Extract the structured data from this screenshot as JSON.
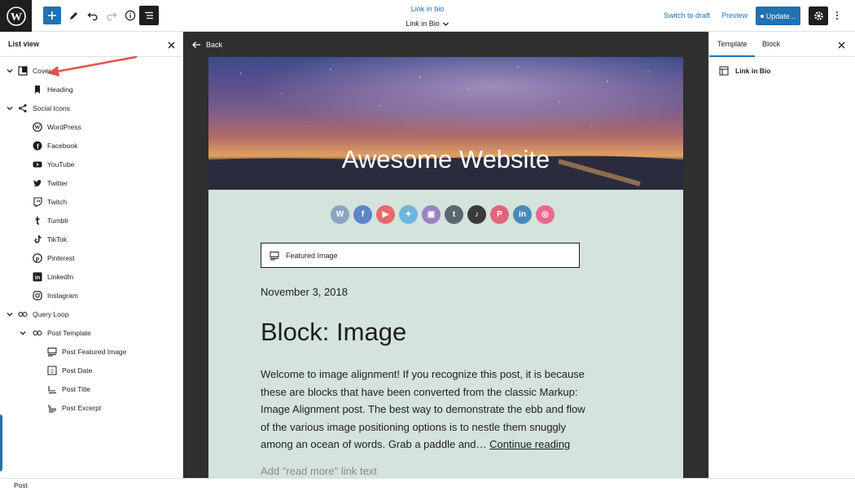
{
  "topbar": {
    "doc_subtitle": "Link in bio",
    "doc_title": "Link in Bio",
    "switch_draft": "Switch to draft",
    "preview": "Preview",
    "update": "Update..."
  },
  "list_view": {
    "title": "List view",
    "items": [
      {
        "label": "Cover",
        "level": 0,
        "icon": "cover-icon",
        "chevron": true
      },
      {
        "label": "Heading",
        "level": 1,
        "icon": "bookmark-icon",
        "chevron": false
      },
      {
        "label": "Social Icons",
        "level": 0,
        "icon": "share-icon",
        "chevron": true
      },
      {
        "label": "WordPress",
        "level": 1,
        "icon": "wordpress-icon",
        "chevron": false
      },
      {
        "label": "Facebook",
        "level": 1,
        "icon": "facebook-icon",
        "chevron": false
      },
      {
        "label": "YouTube",
        "level": 1,
        "icon": "youtube-icon",
        "chevron": false
      },
      {
        "label": "Twitter",
        "level": 1,
        "icon": "twitter-icon",
        "chevron": false
      },
      {
        "label": "Twitch",
        "level": 1,
        "icon": "twitch-icon",
        "chevron": false
      },
      {
        "label": "Tumblr",
        "level": 1,
        "icon": "tumblr-icon",
        "chevron": false
      },
      {
        "label": "TikTok",
        "level": 1,
        "icon": "tiktok-icon",
        "chevron": false
      },
      {
        "label": "Pinterest",
        "level": 1,
        "icon": "pinterest-icon",
        "chevron": false
      },
      {
        "label": "LinkedIn",
        "level": 1,
        "icon": "linkedin-icon",
        "chevron": false
      },
      {
        "label": "Instagram",
        "level": 1,
        "icon": "instagram-icon",
        "chevron": false
      },
      {
        "label": "Query Loop",
        "level": 0,
        "icon": "loop-icon",
        "chevron": true
      },
      {
        "label": "Post Template",
        "level": 1,
        "icon": "loop-icon",
        "chevron": true
      },
      {
        "label": "Post Featured Image",
        "level": 2,
        "icon": "featured-image-icon",
        "chevron": false
      },
      {
        "label": "Post Date",
        "level": 2,
        "icon": "calendar-icon",
        "chevron": false
      },
      {
        "label": "Post Title",
        "level": 2,
        "icon": "title-icon",
        "chevron": false
      },
      {
        "label": "Post Excerpt",
        "level": 2,
        "icon": "excerpt-icon",
        "chevron": false
      }
    ]
  },
  "canvas": {
    "back": "Back",
    "cover_title": "Awesome Website",
    "socials": [
      {
        "name": "wordpress-icon",
        "color": "#8aa5c4"
      },
      {
        "name": "facebook-icon",
        "color": "#5d86c6"
      },
      {
        "name": "youtube-icon",
        "color": "#e8686c"
      },
      {
        "name": "twitter-icon",
        "color": "#6db6e0"
      },
      {
        "name": "twitch-icon",
        "color": "#9c82c4"
      },
      {
        "name": "tumblr-icon",
        "color": "#5a6670"
      },
      {
        "name": "tiktok-icon",
        "color": "#3a3a3a"
      },
      {
        "name": "pinterest-icon",
        "color": "#e0647a"
      },
      {
        "name": "linkedin-icon",
        "color": "#4a8ab8"
      },
      {
        "name": "instagram-icon",
        "color": "#ec6890"
      }
    ],
    "featured_image": "Featured Image",
    "post_date": "November 3, 2018",
    "post_title": "Block: Image",
    "excerpt": "Welcome to image alignment! If you recognize this post, it is because these are blocks that have been converted from the classic Markup: Image Alignment post. The best way to demonstrate the ebb and flow of the various image positioning options is to nestle them snuggly among an ocean of words. Grab a paddle and…",
    "continue_reading": "Continue reading",
    "read_more_placeholder": "Add \"read more\" link text"
  },
  "sidebar": {
    "tab_template": "Template",
    "tab_block": "Block",
    "template_name": "Link in Bio"
  },
  "statusbar": {
    "breadcrumb": "Post"
  },
  "colors": {
    "accent": "#2271b1",
    "dark": "#1e1e1e",
    "canvas_bg": "#2f2f2f",
    "page_bg": "#d4e3dc"
  }
}
